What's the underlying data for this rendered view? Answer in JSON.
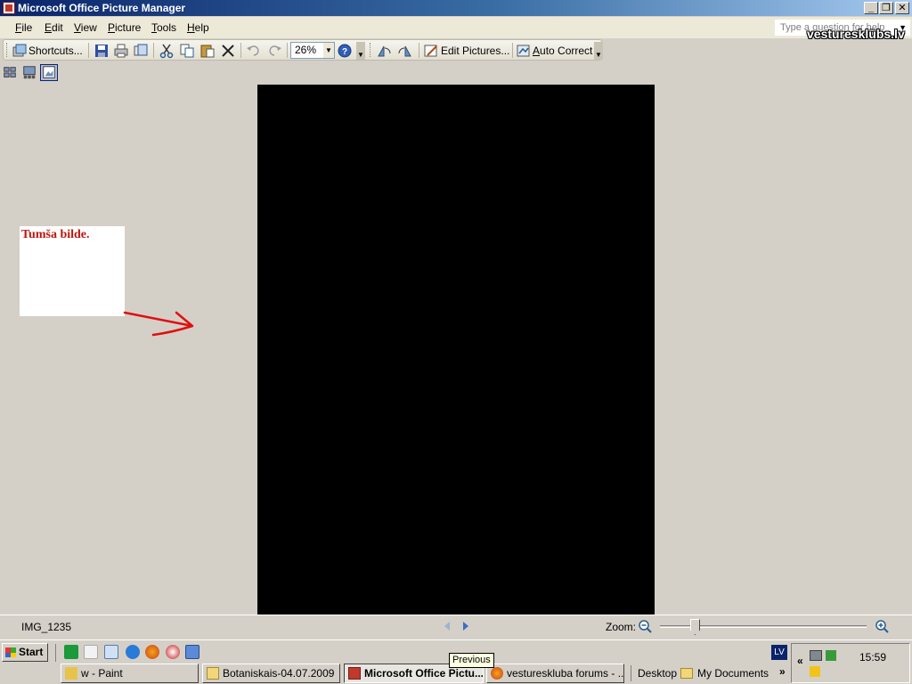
{
  "window": {
    "title": "Microsoft Office Picture Manager",
    "controls": {
      "minimize": "_",
      "restore": "❐",
      "close": "✕"
    }
  },
  "menubar": {
    "items": [
      {
        "prefix": "",
        "accel": "F",
        "rest": "ile"
      },
      {
        "prefix": "",
        "accel": "E",
        "rest": "dit"
      },
      {
        "prefix": "",
        "accel": "V",
        "rest": "iew"
      },
      {
        "prefix": "",
        "accel": "P",
        "rest": "icture"
      },
      {
        "prefix": "",
        "accel": "T",
        "rest": "ools"
      },
      {
        "prefix": "",
        "accel": "H",
        "rest": "elp"
      }
    ],
    "help_placeholder": "Type a question for help"
  },
  "toolbar": {
    "shortcuts_label": "Shortcuts...",
    "zoom_value": "26%",
    "edit_pictures_label": "Edit Pictures...",
    "auto_correct_accel": "A",
    "auto_correct_rest": "uto Correct"
  },
  "note": {
    "text": "Tumša bilde."
  },
  "statusbar": {
    "filename": "IMG_1235",
    "zoom_label": "Zoom:",
    "zoom_fraction": 0.17
  },
  "tooltip": {
    "text": "Previous"
  },
  "taskbar": {
    "start_label": "Start",
    "tasks": [
      {
        "label": "w - Paint"
      },
      {
        "label": "Botaniskais-04.07.2009"
      },
      {
        "label": "Microsoft Office Pictu..."
      },
      {
        "label": "vestureskluba forums - ..."
      }
    ],
    "desktop_label": "Desktop",
    "my_documents_label": "My Documents",
    "language": "LV",
    "clock": "15:59"
  },
  "watermark": "vesturesklūbs.lv",
  "colors": {
    "title_gradient_start": "#0a246a",
    "note_text": "#c0140c",
    "arrow": "#e01010"
  }
}
